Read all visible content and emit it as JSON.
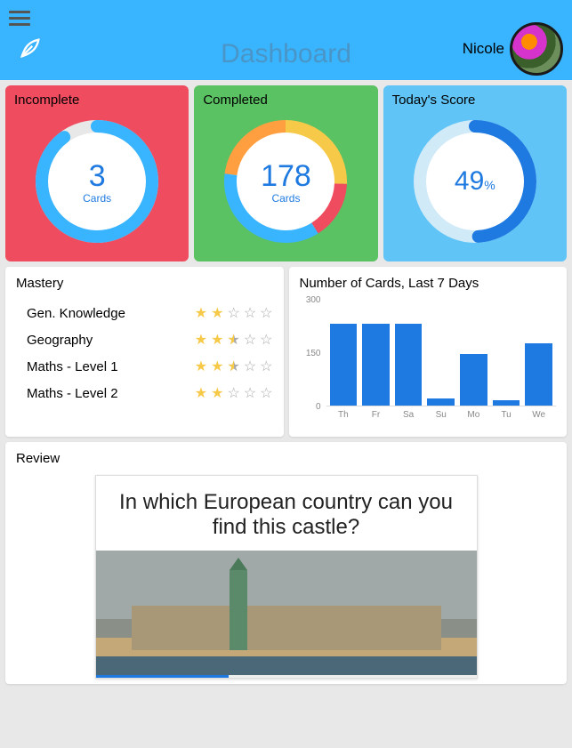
{
  "header": {
    "title": "Dashboard",
    "user": "Nicole"
  },
  "stats": {
    "incomplete": {
      "title": "Incomplete",
      "value": "3",
      "sub": "Cards"
    },
    "completed": {
      "title": "Completed",
      "value": "178",
      "sub": "Cards"
    },
    "score": {
      "title": "Today's Score",
      "value": "49",
      "sub": "%"
    }
  },
  "mastery": {
    "title": "Mastery",
    "rows": [
      {
        "label": "Gen. Knowledge",
        "stars": 2.0
      },
      {
        "label": "Geography",
        "stars": 2.5
      },
      {
        "label": "Maths - Level 1",
        "stars": 2.5
      },
      {
        "label": "Maths - Level 2",
        "stars": 2.0
      }
    ]
  },
  "chart": {
    "title": "Number of Cards, Last 7 Days"
  },
  "chart_data": {
    "type": "bar",
    "categories": [
      "Th",
      "Fr",
      "Sa",
      "Su",
      "Mo",
      "Tu",
      "We"
    ],
    "values": [
      230,
      230,
      230,
      20,
      145,
      15,
      175
    ],
    "ylim": [
      0,
      300
    ],
    "yticks": [
      0,
      150,
      300
    ],
    "xlabel": "",
    "ylabel": ""
  },
  "review": {
    "title": "Review",
    "question": "In which European country can you find this castle?"
  }
}
